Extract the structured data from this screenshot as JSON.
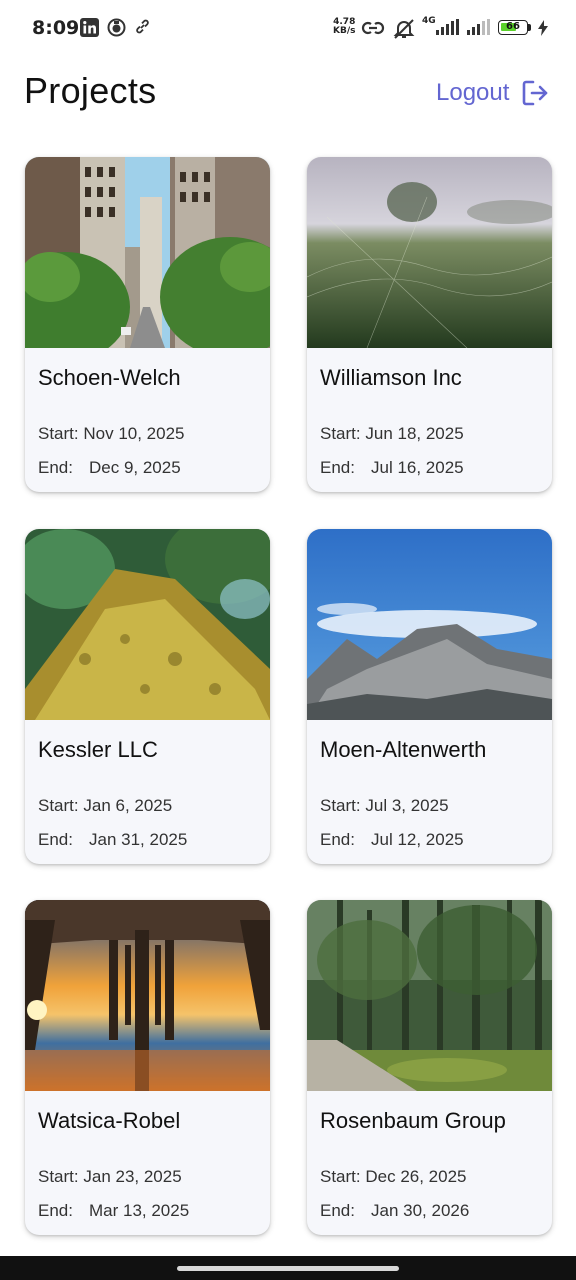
{
  "status_bar": {
    "time": "8:09",
    "net_speed_value": "4.78",
    "net_speed_unit": "KB/s",
    "network_type": "4G",
    "battery": "66",
    "icons": [
      "linkedin-icon",
      "app-notification-icon",
      "link-icon",
      "hotspot-icon",
      "mute-icon",
      "signal-icon",
      "signal-icon",
      "battery-icon",
      "charging-icon"
    ]
  },
  "header": {
    "title": "Projects",
    "logout_label": "Logout",
    "logout_icon": "logout-icon",
    "accent_color": "#6366d1"
  },
  "labels": {
    "start": "Start:",
    "end": "End:"
  },
  "projects": [
    {
      "name": "Schoen-Welch",
      "start": "Nov 10, 2025",
      "end": "Dec 9, 2025",
      "image": "city-street-photo"
    },
    {
      "name": "Williamson Inc",
      "start": "Jun 18, 2025",
      "end": "Jul 16, 2025",
      "image": "misty-field-photo"
    },
    {
      "name": "Kessler LLC",
      "start": "Jan 6, 2025",
      "end": "Jan 31, 2025",
      "image": "mossy-tree-photo"
    },
    {
      "name": "Moen-Altenwerth",
      "start": "Jul 3, 2025",
      "end": "Jul 12, 2025",
      "image": "mountain-photo"
    },
    {
      "name": "Watsica-Robel",
      "start": "Jan 23, 2025",
      "end": "Mar 13, 2025",
      "image": "pier-sunset-photo"
    },
    {
      "name": "Rosenbaum Group",
      "start": "Dec 26, 2025",
      "end": "Jan 30, 2026",
      "image": "forest-path-photo"
    }
  ]
}
